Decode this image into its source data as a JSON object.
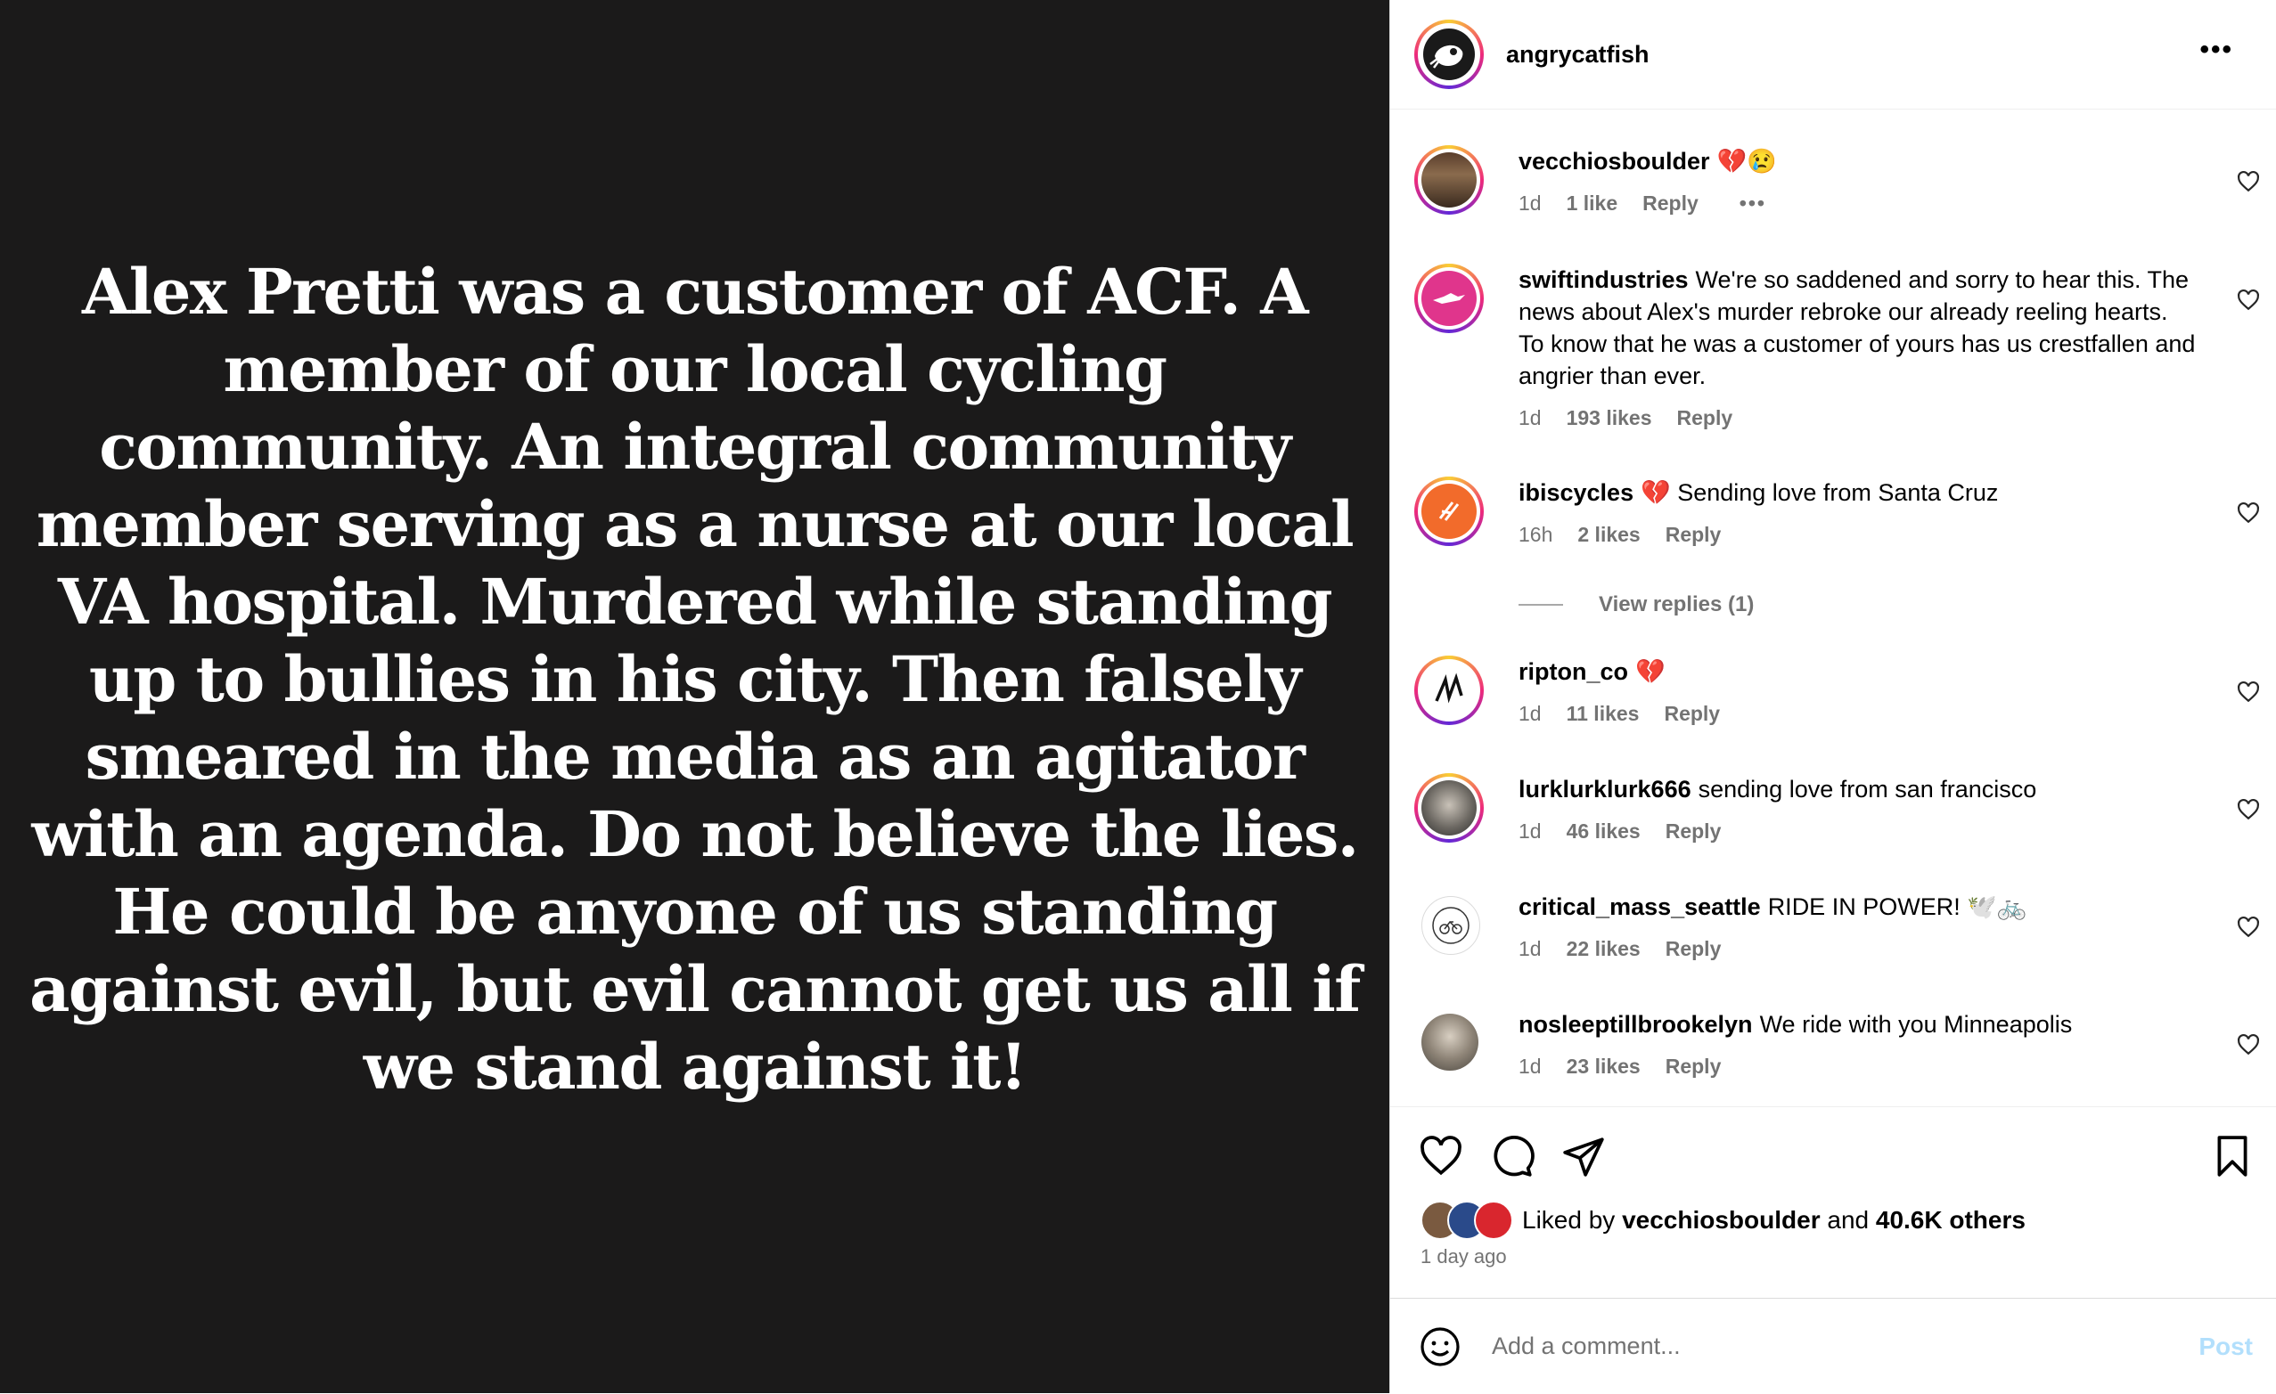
{
  "post": {
    "text": "Alex Pretti was a customer of ACF. A member of our local cycling community. An integral community member serving as a nurse at our local VA hospital. Murdered while standing up to bullies in his city. Then falsely smeared in the media as an agitator with an agenda. Do not believe the lies. He could be anyone of us standing against evil, but evil cannot get us all if we stand against it!",
    "background": "#1b1a1a"
  },
  "header": {
    "username": "angrycatfish",
    "more_icon": "more-horizontal-icon"
  },
  "comments": [
    {
      "username": "vecchiosboulder",
      "text": "💔😢",
      "age": "1d",
      "likes": "1 like",
      "reply": "Reply",
      "more": "•••"
    },
    {
      "username": "swiftindustries",
      "text": "We're so saddened and sorry to hear this. The news about Alex's murder rebroke our already reeling hearts. To know that he was a customer of yours has us crestfallen and angrier than ever.",
      "age": "1d",
      "likes": "193 likes",
      "reply": "Reply"
    },
    {
      "username": "ibiscycles",
      "text": "💔 Sending love from Santa Cruz",
      "age": "16h",
      "likes": "2 likes",
      "reply": "Reply",
      "view_replies": "View replies (1)"
    },
    {
      "username": "ripton_co",
      "text": "💔",
      "age": "1d",
      "likes": "11 likes",
      "reply": "Reply"
    },
    {
      "username": "lurklurklurk666",
      "text": "sending love from san francisco",
      "age": "1d",
      "likes": "46 likes",
      "reply": "Reply"
    },
    {
      "username": "critical_mass_seattle",
      "text": "RIDE IN POWER! 🕊️🚲",
      "age": "1d",
      "likes": "22 likes",
      "reply": "Reply"
    },
    {
      "username": "nosleeptillbrookelyn",
      "text": "We ride with you Minneapolis",
      "age": "1d",
      "likes": "23 likes",
      "reply": "Reply"
    }
  ],
  "actions": {
    "liked_prefix": "Liked by",
    "liked_user": "vecchiosboulder",
    "liked_and": "and",
    "liked_count": "40.6K others",
    "timestamp": "1 day ago"
  },
  "composer": {
    "placeholder": "Add a comment...",
    "post_label": "Post"
  }
}
